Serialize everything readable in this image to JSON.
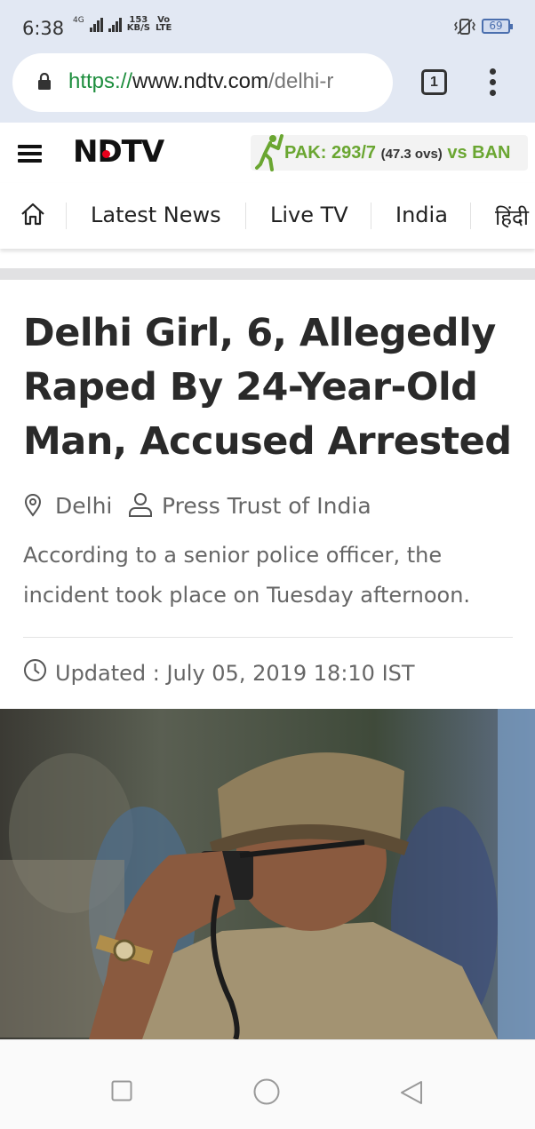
{
  "status": {
    "time": "6:38",
    "network": "4G",
    "speed_value": "153",
    "speed_unit": "KB/S",
    "volte_top": "Vo",
    "volte_bottom": "LTE",
    "battery": "69"
  },
  "browser": {
    "url_scheme": "https://",
    "url_host": "www.ndtv.com",
    "url_path": "/delhi-r",
    "tab_count": "1"
  },
  "site": {
    "logo": "NDTV",
    "score": {
      "team_score": "PAK: 293/7",
      "overs": "(47.3 ovs)",
      "opponent": "vs BAN"
    },
    "nav": [
      "Latest News",
      "Live TV",
      "India",
      "हिंदी"
    ]
  },
  "article": {
    "headline": "Delhi Girl, 6, Allegedly Raped By 24-Year-Old Man, Accused Arrested",
    "location": "Delhi",
    "author": "Press Trust of India",
    "summary": "According to a senior police officer, the incident took place on Tuesday afternoon.",
    "updated": "Updated : July 05, 2019 18:10 IST"
  },
  "icons": {
    "home": "home-icon",
    "pin": "location-pin-icon",
    "person": "person-icon",
    "clock": "clock-icon"
  },
  "colors": {
    "url_scheme": "#1e8e3e",
    "score_green": "#6aa631",
    "logo_red": "#e8001c"
  }
}
